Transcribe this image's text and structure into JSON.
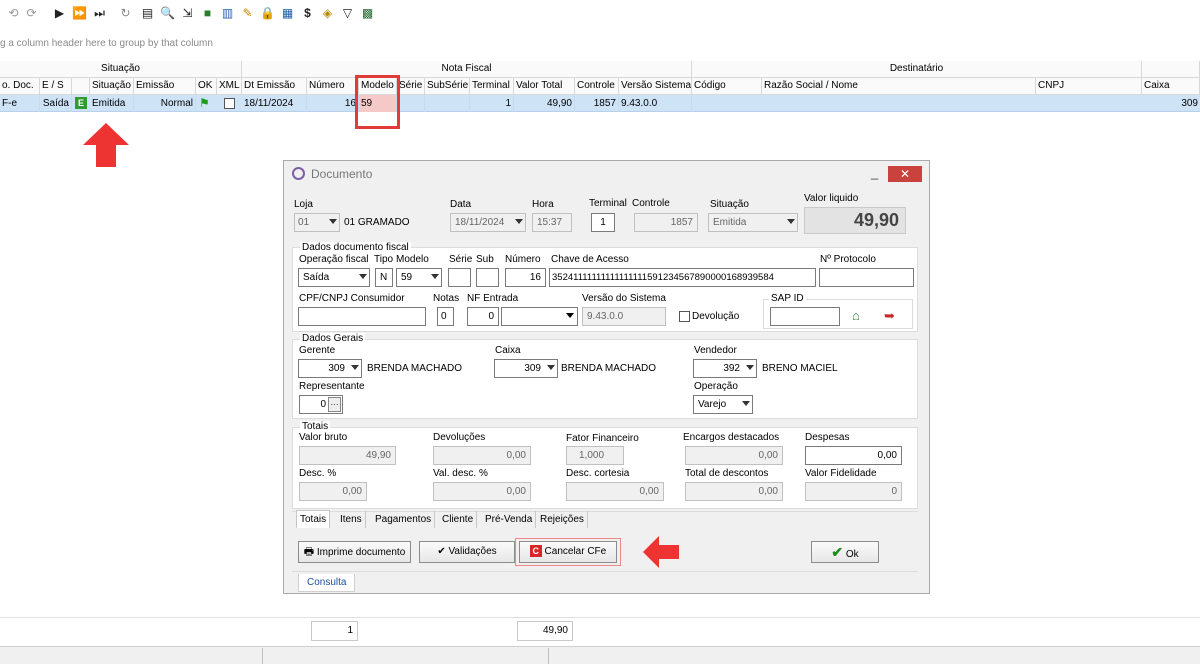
{
  "toolbar": {
    "icons": [
      "undo-icon",
      "redo-icon",
      "play-icon",
      "fast-forward-icon",
      "skip-end-icon",
      "refresh-icon",
      "print-setup-icon",
      "print-preview-icon",
      "export-icon",
      "book-icon",
      "books-icon",
      "pencil-icon",
      "lock-icon",
      "calculator-icon",
      "dollar-icon",
      "package-icon",
      "filter-icon",
      "grid-icon"
    ]
  },
  "group_hint": "g a column header here to group by that column",
  "grid": {
    "band_headers": {
      "situacao": "Situação",
      "nota_fiscal": "Nota Fiscal",
      "destinatario": "Destinatário"
    },
    "columns": {
      "tipo": "o. Doc.",
      "es": "E / S",
      "situacao": "Situação",
      "emissao": "Emissão",
      "ok": "OK",
      "xml": "XML",
      "dt_emissao": "Dt Emissão",
      "numero": "Número",
      "modelo": "Modelo",
      "serie": "Série",
      "subserie": "SubSérie",
      "terminal": "Terminal",
      "valor_total": "Valor Total",
      "controle": "Controle",
      "versao": "Versão Sistema",
      "codigo": "Código",
      "razao": "Razão Social / Nome",
      "cnpj": "CNPJ",
      "caixa": "Caixa"
    },
    "row": {
      "tipo": "F-e",
      "es": "Saída",
      "situacao_badge": "E",
      "situacao": "Emitida",
      "emissao": "Normal",
      "dt_emissao": "18/11/2024",
      "numero": "16",
      "modelo": "59",
      "terminal": "1",
      "valor_total": "49,90",
      "controle": "1857",
      "versao": "9.43.0.0",
      "caixa": "309"
    }
  },
  "dialog": {
    "title": "Documento",
    "loja_label": "Loja",
    "loja_code": "01",
    "loja_name": "01 GRAMADO",
    "data_label": "Data",
    "data_value": "18/11/2024",
    "hora_label": "Hora",
    "hora_value": "15:37",
    "terminal_label": "Terminal",
    "terminal_value": "1",
    "controle_label": "Controle",
    "controle_value": "1857",
    "situacao_label": "Situação",
    "situacao_value": "Emitida",
    "valor_liquido_label": "Valor liquido",
    "valor_liquido": "49,90",
    "fiscal": {
      "title": "Dados documento fiscal",
      "operacao_label": "Operação fiscal",
      "operacao_value": "Saída",
      "tipo_label": "Tipo",
      "tipo_value": "N",
      "modelo_label": "Modelo",
      "modelo_value": "59",
      "serie_label": "Série",
      "sub_label": "Sub",
      "numero_label": "Número",
      "numero_value": "16",
      "chave_label": "Chave de Acesso",
      "chave_value": "35241111111111111111591234567890000168939584",
      "protocolo_label": "Nº Protocolo",
      "cpf_label": "CPF/CNPJ Consumidor",
      "notas_label": "Notas",
      "notas_value": "0",
      "nf_entrada_label": "NF Entrada",
      "nf_entrada_value": "0",
      "versao_label": "Versão do Sistema",
      "versao_value": "9.43.0.0",
      "devolucao_label": "Devolução",
      "sap_label": "SAP ID"
    },
    "gerais": {
      "title": "Dados Gerais",
      "gerente_label": "Gerente",
      "gerente_code": "309",
      "gerente_name": "BRENDA MACHADO",
      "caixa_label": "Caixa",
      "caixa_code": "309",
      "caixa_name": "BRENDA MACHADO",
      "vendedor_label": "Vendedor",
      "vendedor_code": "392",
      "vendedor_name": "BRENO MACIEL",
      "representante_label": "Representante",
      "representante_value": "0",
      "operacao_label": "Operação",
      "operacao_value": "Varejo"
    },
    "totais": {
      "title": "Totais",
      "valor_bruto_label": "Valor bruto",
      "valor_bruto": "49,90",
      "devolucoes_label": "Devoluções",
      "devolucoes": "0,00",
      "fator_label": "Fator Financeiro",
      "fator": "1,000",
      "encargos_label": "Encargos destacados",
      "encargos": "0,00",
      "despesas_label": "Despesas",
      "despesas": "0,00",
      "desc_pct_label": "Desc. %",
      "desc_pct": "0,00",
      "val_desc_label": "Val. desc. %",
      "val_desc": "0,00",
      "desc_cortesia_label": "Desc. cortesia",
      "desc_cortesia": "0,00",
      "total_desc_label": "Total de descontos",
      "total_desc": "0,00",
      "fidelidade_label": "Valor Fidelidade",
      "fidelidade": "0"
    },
    "tabs": [
      "Totais",
      "Itens",
      "Pagamentos",
      "Cliente",
      "Pré-Venda",
      "Rejeições"
    ],
    "buttons": {
      "imprime": "Imprime documento",
      "validacoes": "Validações",
      "cancelar": "Cancelar CFe",
      "ok": "Ok"
    },
    "status_tab": "Consulta"
  },
  "footer": {
    "count": "1",
    "total": "49,90"
  },
  "colors": {
    "selection": "#cfe3f7",
    "highlight": "#e33a3a",
    "ok_check": "#1a8f1a",
    "cancel_icon": "#d7262c"
  }
}
